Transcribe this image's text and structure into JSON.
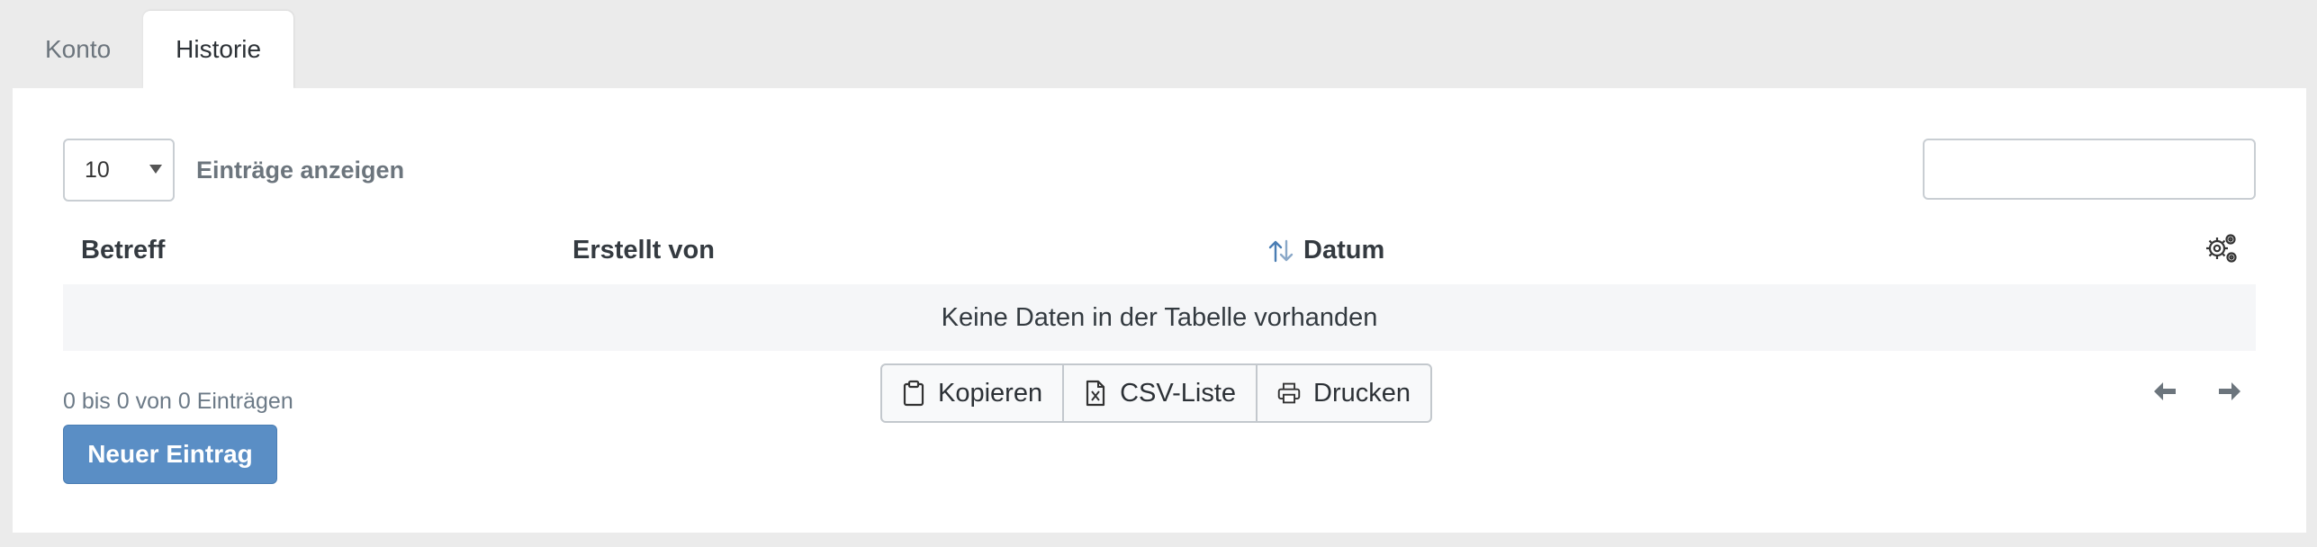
{
  "tabs": [
    {
      "label": "Konto",
      "active": false
    },
    {
      "label": "Historie",
      "active": true
    }
  ],
  "table_controls": {
    "length_value": "10",
    "length_label": "Einträge anzeigen",
    "search_value": ""
  },
  "table": {
    "columns": [
      "Betreff",
      "Erstellt von",
      "Datum"
    ],
    "sorted_column": "Datum",
    "empty_message": "Keine Daten in der Tabelle vorhanden",
    "info": "0 bis 0 von 0 Einträgen"
  },
  "export_buttons": {
    "copy": "Kopieren",
    "csv": "CSV-Liste",
    "print": "Drucken"
  },
  "actions": {
    "new_entry": "Neuer Eintrag"
  },
  "colors": {
    "primary": "#5a8ec5",
    "sort_icon": "#4a7db3"
  }
}
